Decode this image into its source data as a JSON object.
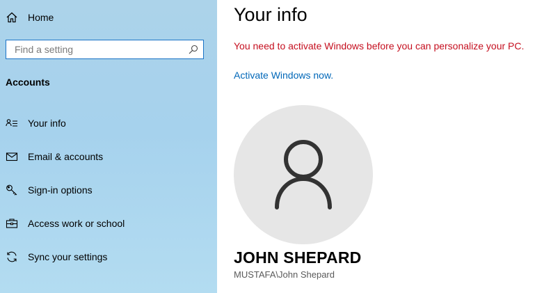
{
  "sidebar": {
    "home": {
      "label": "Home",
      "icon": "home-icon"
    },
    "search": {
      "placeholder": "Find a setting",
      "value": "",
      "icon": "search-icon"
    },
    "section_title": "Accounts",
    "items": [
      {
        "label": "Your info",
        "icon": "person-card-icon",
        "selected": true
      },
      {
        "label": "Email & accounts",
        "icon": "mail-icon"
      },
      {
        "label": "Sign-in options",
        "icon": "key-icon"
      },
      {
        "label": "Access work or school",
        "icon": "briefcase-icon"
      },
      {
        "label": "Sync your settings",
        "icon": "sync-icon"
      }
    ]
  },
  "main": {
    "title": "Your info",
    "warning": "You need to activate Windows before you can personalize your PC.",
    "activate_link": "Activate Windows now.",
    "user": {
      "name": "JOHN SHEPARD",
      "account": "MUSTAFA\\John Shepard",
      "avatar_icon": "user-silhouette-icon"
    }
  },
  "colors": {
    "sidebar_bg": "#a9d4ec",
    "warning": "#c50f1f",
    "link": "#0067b8",
    "avatar_bg": "#e6e6e6",
    "search_border": "#1a73c6"
  }
}
